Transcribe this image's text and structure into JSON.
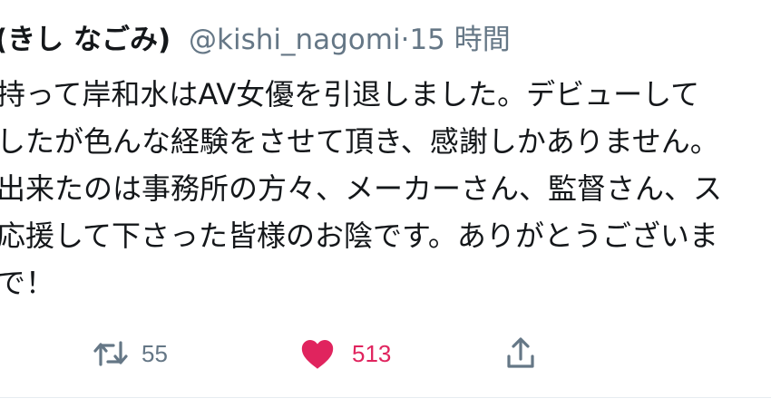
{
  "tweet": {
    "display_name": "(きし なごみ)",
    "handle": "@kishi_nagomi",
    "separator": "·",
    "timestamp": "15 時間",
    "lines": [
      "持って岸和水はAV女優を引退しました。デビューして",
      "したが色んな経験をさせて頂き、感謝しかありません。",
      "出来たのは事務所の方々、メーカーさん、監督さん、ス",
      "応援して下さった皆様のお陰です。ありがとうございま",
      "で！"
    ]
  },
  "actions": {
    "retweet": {
      "icon": "retweet-icon",
      "count": "55",
      "color": "#657786"
    },
    "like": {
      "icon": "heart-icon",
      "count": "513",
      "color": "#e0245e"
    },
    "share": {
      "icon": "share-icon"
    }
  }
}
